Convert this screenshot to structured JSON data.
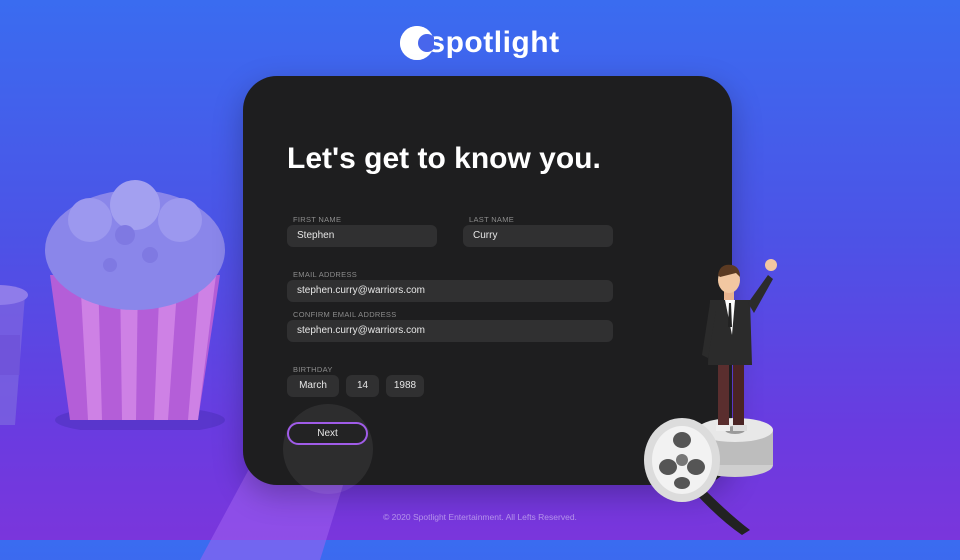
{
  "brand": {
    "name": "spotlight"
  },
  "form": {
    "heading": "Let's get to know you.",
    "first_name": {
      "label": "FIRST NAME",
      "value": "Stephen"
    },
    "last_name": {
      "label": "LAST NAME",
      "value": "Curry"
    },
    "email": {
      "label": "EMAIL ADDRESS",
      "value": "stephen.curry@warriors.com"
    },
    "confirm_email": {
      "label": "CONFIRM EMAIL ADDRESS",
      "value": "stephen.curry@warriors.com"
    },
    "birthday": {
      "label": "BIRTHDAY",
      "month": "March",
      "day": "14",
      "year": "1988"
    },
    "next_label": "Next"
  },
  "footer": {
    "text": "© 2020 Spotlight Entertainment. All Lefts Reserved."
  },
  "colors": {
    "accent": "#a05ce8",
    "card": "#1e1e1f",
    "field": "#303031"
  },
  "icons": [
    "spotlight-logo-icon",
    "popcorn-illustration",
    "cup-illustration",
    "film-reel-illustration",
    "man-waving-illustration"
  ]
}
